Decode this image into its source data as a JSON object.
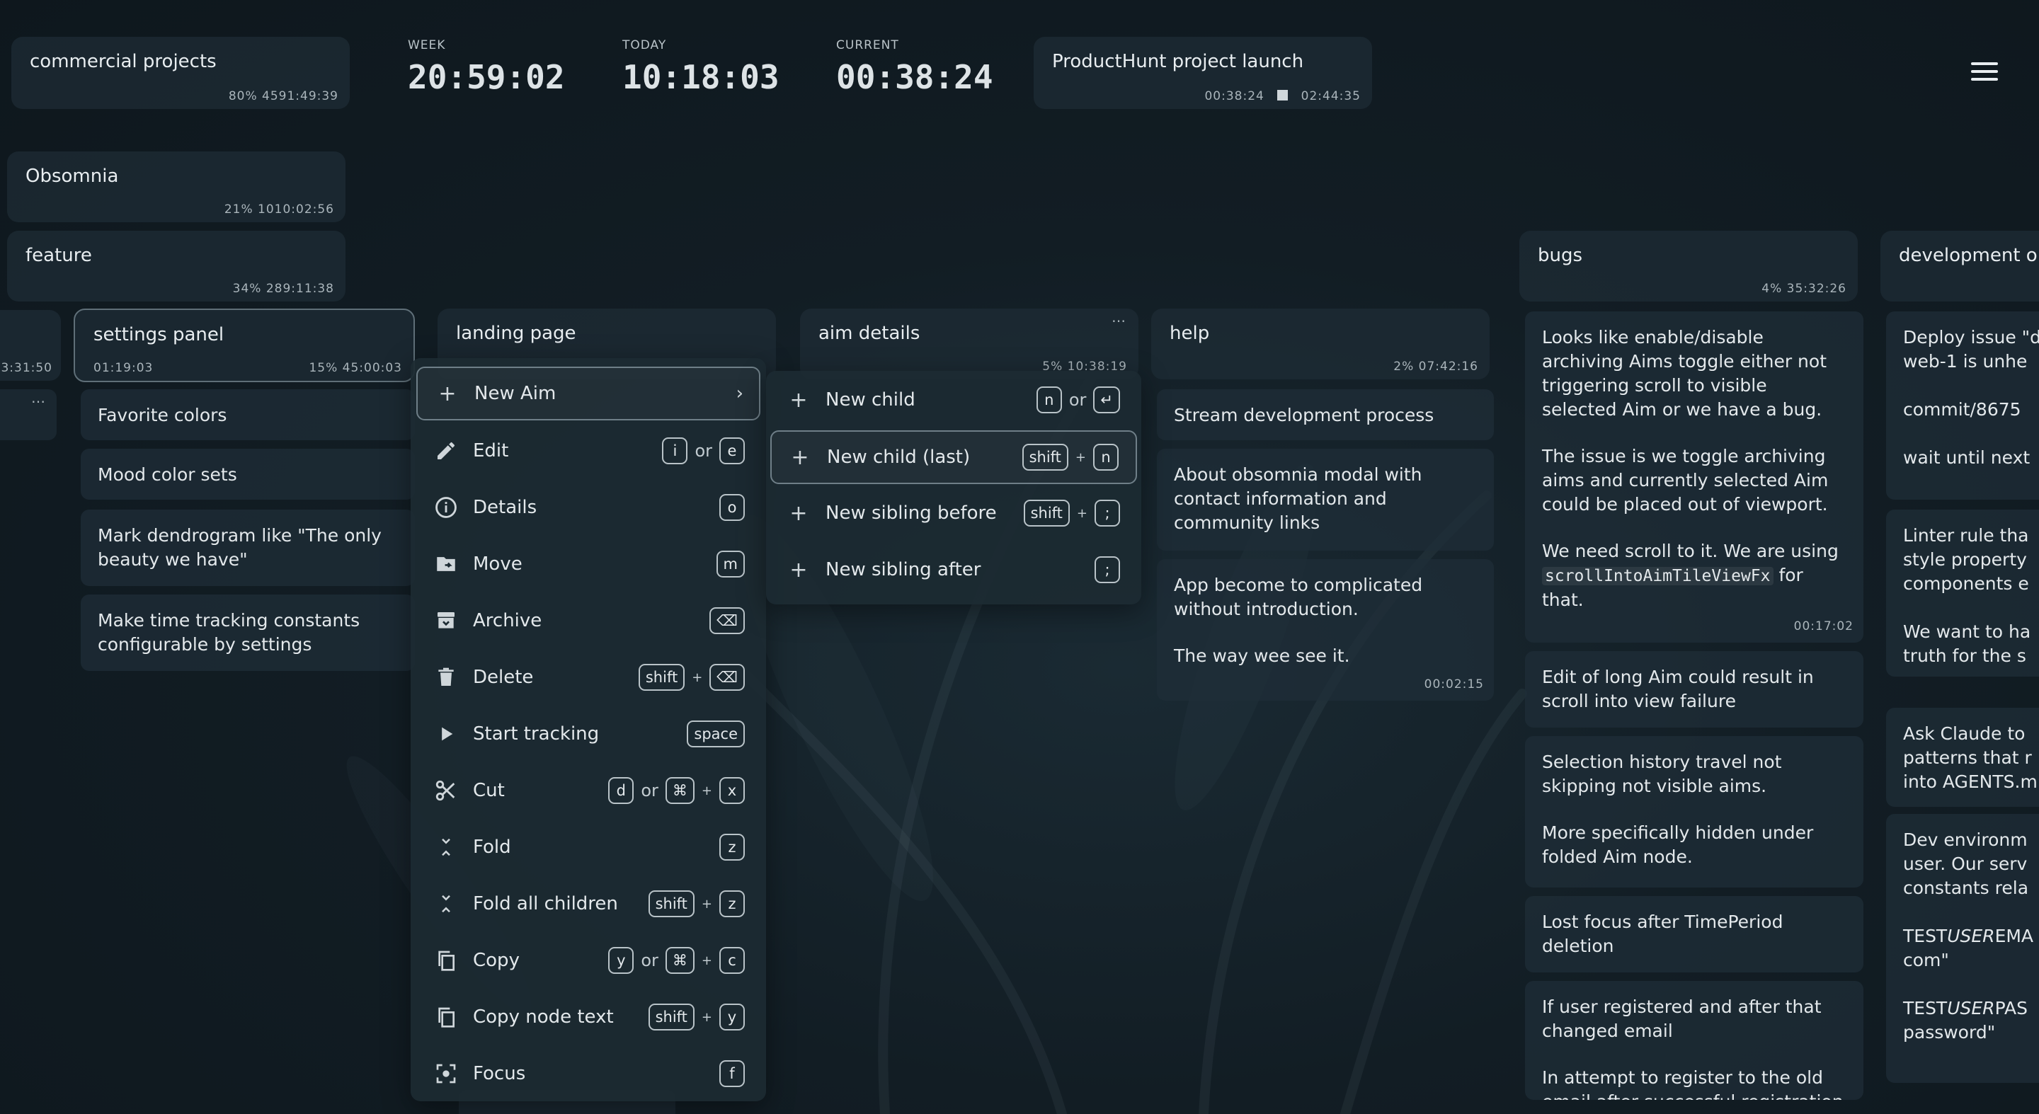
{
  "header": {
    "current_project": {
      "title": "commercial projects",
      "percent": "80%",
      "time": "4591:49:39"
    },
    "stats": [
      {
        "label": "WEEK",
        "value": "20:59:02"
      },
      {
        "label": "TODAY",
        "value": "10:18:03"
      },
      {
        "label": "CURRENT",
        "value": "00:38:24"
      }
    ],
    "tracking": {
      "title": "ProductHunt project launch",
      "elapsed": "00:38:24",
      "total": "02:44:35"
    },
    "menu_icon": "hamburger-menu-icon"
  },
  "tree": {
    "obsomnia": {
      "title": "Obsomnia",
      "percent": "21%",
      "time": "1010:02:56"
    },
    "feature": {
      "title": "feature",
      "percent": "34%",
      "time": "289:11:38"
    },
    "left_clip": {
      "time": "3:31:50",
      "ellipsis": "…"
    },
    "settings_panel": {
      "title": "settings panel",
      "start": "01:19:03",
      "percent": "15%",
      "time": "45:00:03"
    },
    "landing_page": {
      "title": "landing page"
    },
    "aim_details": {
      "title": "aim details",
      "meta": "5% 10:38:19",
      "ellipsis": "…"
    },
    "help": {
      "title": "help",
      "percent": "2%",
      "time": "07:42:16"
    },
    "bugs": {
      "title": "bugs",
      "percent": "4%",
      "time": "35:32:26"
    },
    "development": {
      "title": "development o"
    }
  },
  "settings_children": [
    "Favorite colors",
    "Mood color sets",
    "Mark dendrogram like \"The only beauty we have\"",
    "Make time tracking constants configurable by settings"
  ],
  "help_children": {
    "c1": "Stream development process",
    "c2": "About obsomnia modal with contact information and community links",
    "c3p1": "App become to complicated without introduction.",
    "c3p2": "The way wee see it.",
    "c3time": "00:02:15"
  },
  "bugs_children": {
    "b1p1": "Looks like enable/disable archiving Aims toggle either not triggering scroll to visible selected Aim or we have a bug.",
    "b1p2": "The issue is we toggle archiving aims and currently selected Aim could be placed out of viewport.",
    "b1p3a": "We need scroll to it. We are using ",
    "b1code": "scrollIntoAimTileViewFx",
    "b1p3b": " for that.",
    "b1time": "00:17:02",
    "b2": "Edit of long Aim could result in scroll into view failure",
    "b3p1": "Selection history travel not skipping not visible aims.",
    "b3p2": "More specifically hidden under folded Aim node.",
    "b4": "Lost focus after TimePeriod deletion",
    "b5p1": "If user registered and after that changed email",
    "b5p2": "In attempt to register to the old email after successful registration"
  },
  "dev_children": {
    "d1a": "Deploy issue \"d",
    "d1b": "web-1 is unhe",
    "d1c": "commit/8675",
    "d1d": "wait until next",
    "d2a": "Linter rule tha",
    "d2b": "style property",
    "d2c": "components e",
    "d2d": "We want to ha",
    "d2e": "truth for the s",
    "d3a": "Ask Claude to",
    "d3b": "patterns that r",
    "d3c": "into AGENTS.m",
    "d4a": "Dev environm",
    "d4b": "user. Our serv",
    "d4c": "constants rela",
    "d4d1": "TEST",
    "d4d2": "USER",
    "d4d3": "EMA",
    "d4e": "com\"",
    "d4f1": "TEST",
    "d4f2": "USER",
    "d4f3": "PAS",
    "d4g": "password\""
  },
  "context_menu": {
    "items": [
      {
        "label": "New Aim",
        "icon": "plus-icon",
        "keys": [],
        "arrow": "›"
      },
      {
        "label": "Edit",
        "icon": "pencil-icon",
        "keys": [
          "i",
          "or",
          "e"
        ]
      },
      {
        "label": "Details",
        "icon": "info-icon",
        "keys": [
          "o"
        ]
      },
      {
        "label": "Move",
        "icon": "folder-move-icon",
        "keys": [
          "m"
        ]
      },
      {
        "label": "Archive",
        "icon": "archive-icon",
        "keys": [
          "⌫"
        ]
      },
      {
        "label": "Delete",
        "icon": "trash-icon",
        "keys": [
          "shift",
          "+",
          "⌫"
        ]
      },
      {
        "label": "Start tracking",
        "icon": "play-icon",
        "keys": [
          "space"
        ]
      },
      {
        "label": "Cut",
        "icon": "scissors-icon",
        "keys": [
          "d",
          "or",
          "⌘",
          "+",
          "x"
        ]
      },
      {
        "label": "Fold",
        "icon": "fold-icon",
        "keys": [
          "z"
        ]
      },
      {
        "label": "Fold all children",
        "icon": "fold-all-icon",
        "keys": [
          "shift",
          "+",
          "z"
        ]
      },
      {
        "label": "Copy",
        "icon": "copy-icon",
        "keys": [
          "y",
          "or",
          "⌘",
          "+",
          "c"
        ]
      },
      {
        "label": "Copy node text",
        "icon": "copy-text-icon",
        "keys": [
          "shift",
          "+",
          "y"
        ]
      },
      {
        "label": "Focus",
        "icon": "focus-icon",
        "keys": [
          "f"
        ]
      }
    ]
  },
  "submenu": {
    "items": [
      {
        "label": "New child",
        "keys": [
          "n",
          "or",
          "↵"
        ]
      },
      {
        "label": "New child (last)",
        "keys": [
          "shift",
          "+",
          "n"
        ]
      },
      {
        "label": "New sibling before",
        "keys": [
          "shift",
          "+",
          ";"
        ]
      },
      {
        "label": "New sibling after",
        "keys": [
          ";"
        ]
      }
    ]
  }
}
